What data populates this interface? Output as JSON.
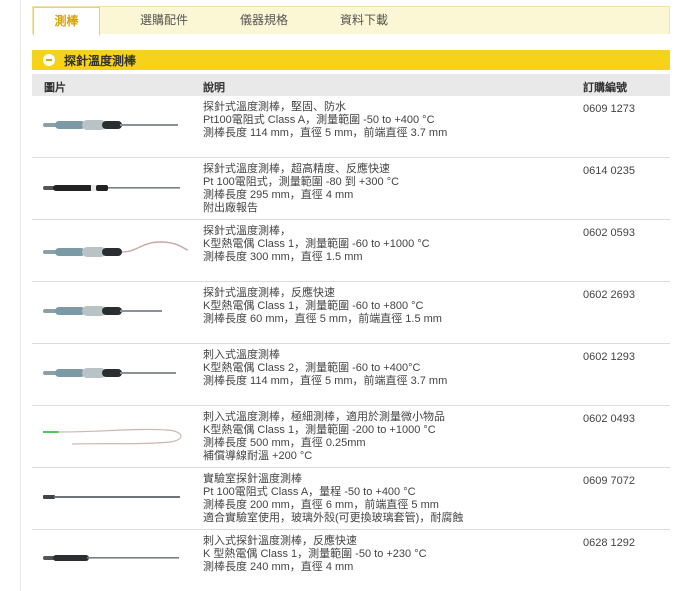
{
  "tabs": [
    {
      "label": "測棒"
    },
    {
      "label": "選購配件"
    },
    {
      "label": "儀器規格"
    },
    {
      "label": "資料下載"
    }
  ],
  "section": {
    "title": "探針溫度測棒",
    "icon": "collapse-minus-icon"
  },
  "table": {
    "headers": {
      "image": "圖片",
      "description": "說明",
      "order_no": "訂購編號"
    },
    "rows": [
      {
        "lines": [
          "探針式溫度測棒，堅固、防水",
          "Pt100電阻式 Class A，測量範圍 -50 to +400 °C",
          "測棒長度 114 mm，直徑 5 mm，前端直徑 3.7 mm"
        ],
        "code": "0609 1273",
        "image": "handle-probe-image"
      },
      {
        "lines": [
          "探針式溫度測棒，超高精度、反應快速",
          "Pt 100電阻式，測量範圍 -80 到 +300 °C",
          "測棒長度 295 mm，直徑 4 mm",
          "附出廠報告"
        ],
        "code": "0614 0235",
        "image": "precision-probe-image"
      },
      {
        "lines": [
          "探針式溫度測棒，",
          "K型熱電偶 Class 1，測量範圍 -60 to +1000 °C",
          "測棒長度 300 mm，直徑 1.5 mm"
        ],
        "code": "0602 0593",
        "image": "cable-probe-image"
      },
      {
        "lines": [
          "探針式溫度測棒，反應快速",
          "K型熱電偶 Class 1，測量範圍 -60 to +800 °C",
          "測棒長度 60 mm，直徑 5 mm，前端直徑 1.5 mm"
        ],
        "code": "0602 2693",
        "image": "handle-probe-image"
      },
      {
        "lines": [
          "刺入式溫度測棒",
          "K型熱電偶 Class 2，測量範圍 -60 to +400°C",
          "測棒長度 114 mm，直徑 5 mm，前端直徑 3.7 mm"
        ],
        "code": "0602 1293",
        "image": "handle-probe-image"
      },
      {
        "lines": [
          "刺入式溫度測棒，極細測棒，適用於測量微小物品",
          "K型熱電偶 Class 1，測量範圍 -200 to +1000 °C",
          "測棒長度 500 mm，直徑 0.25mm",
          "補償導線耐溫 +200 °C"
        ],
        "code": "0602 0493",
        "image": "fine-wire-probe-image"
      },
      {
        "lines": [
          "實驗室探針溫度測棒",
          "Pt 100電阻式 Class A，量程 -50 to +400 °C",
          "測棒長度 200 mm，直徑 6 mm，前端直徑 5 mm",
          "適合實驗室使用，玻璃外殼(可更換玻璃套管)，耐腐蝕"
        ],
        "code": "0609 7072",
        "image": "lab-rod-probe-image"
      },
      {
        "lines": [
          "刺入式探針溫度測棒，反應快速",
          "K 型熱電偶 Class 1，測量範圍 -50 to +230 °C",
          "測棒長度 240 mm，直徑 4 mm"
        ],
        "code": "0628 1292",
        "image": "thin-handle-probe-image"
      }
    ]
  }
}
